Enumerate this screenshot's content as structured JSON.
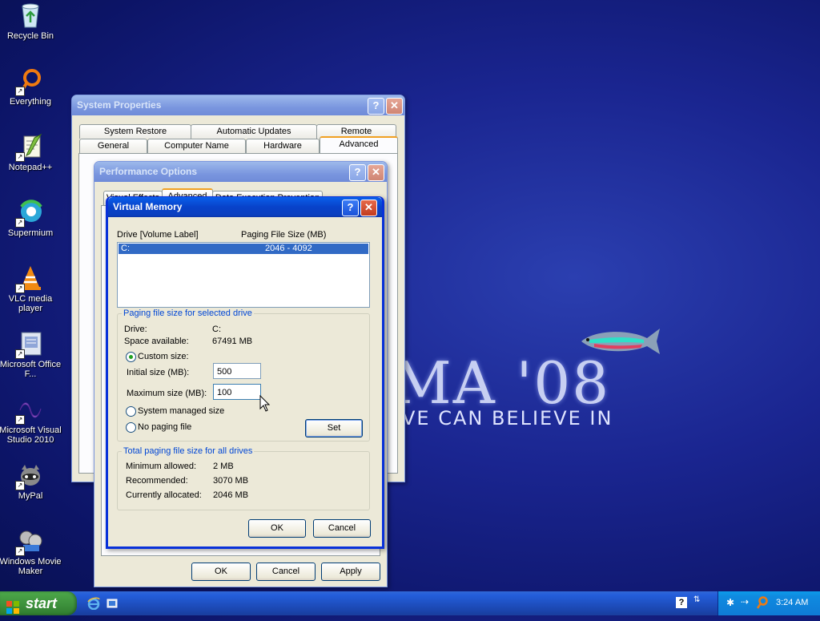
{
  "wallpaper": {
    "big_text": "MA '08",
    "tagline": "VE CAN  BELIEVE IN"
  },
  "desktop_icons": [
    {
      "label": "Recycle Bin",
      "icon": "recycle-bin-icon"
    },
    {
      "label": "Everything",
      "icon": "everything-icon"
    },
    {
      "label": "Notepad++",
      "icon": "notepad-plus-plus-icon"
    },
    {
      "label": "Supermium",
      "icon": "supermium-icon"
    },
    {
      "label": "VLC media player",
      "icon": "vlc-icon"
    },
    {
      "label": "Microsoft Office F...",
      "icon": "office-icon"
    },
    {
      "label": "Microsoft Visual Studio 2010",
      "icon": "visual-studio-icon"
    },
    {
      "label": "MyPal",
      "icon": "mypal-icon"
    },
    {
      "label": "Windows Movie Maker",
      "icon": "movie-maker-icon"
    }
  ],
  "system_properties": {
    "title": "System Properties",
    "tabs_row1": [
      "System Restore",
      "Automatic Updates",
      "Remote"
    ],
    "tabs_row2": [
      "General",
      "Computer Name",
      "Hardware",
      "Advanced"
    ]
  },
  "performance_options": {
    "title": "Performance Options",
    "tabs": [
      "Visual Effects",
      "Advanced",
      "Data Execution Prevention"
    ],
    "buttons": {
      "ok": "OK",
      "cancel": "Cancel",
      "apply": "Apply"
    }
  },
  "virtual_memory": {
    "title": "Virtual Memory",
    "list_headers": {
      "drive": "Drive  [Volume Label]",
      "paging": "Paging File Size (MB)"
    },
    "list_rows": [
      {
        "drive": "C:",
        "size": "2046 - 4092"
      }
    ],
    "selected_group": {
      "label": "Paging file size for selected drive",
      "drive_label": "Drive:",
      "drive_value": "C:",
      "space_label": "Space available:",
      "space_value": "67491 MB",
      "custom_label": "Custom size:",
      "initial_label": "Initial size (MB):",
      "initial_value": "500",
      "maximum_label": "Maximum size (MB):",
      "maximum_value": "100",
      "system_label": "System managed size",
      "none_label": "No paging file",
      "set_label": "Set",
      "selected_option": "custom"
    },
    "total_group": {
      "label": "Total paging file size for all drives",
      "min_label": "Minimum allowed:",
      "min_value": "2 MB",
      "rec_label": "Recommended:",
      "rec_value": "3070 MB",
      "cur_label": "Currently allocated:",
      "cur_value": "2046 MB"
    },
    "buttons": {
      "ok": "OK",
      "cancel": "Cancel"
    }
  },
  "taskbar": {
    "start_label": "start",
    "clock": "3:24 AM"
  },
  "colors": {
    "title_active": "#0a5fea",
    "title_inactive": "#7a96df",
    "dialog_bg": "#ece9d8",
    "selection": "#316ac5"
  }
}
